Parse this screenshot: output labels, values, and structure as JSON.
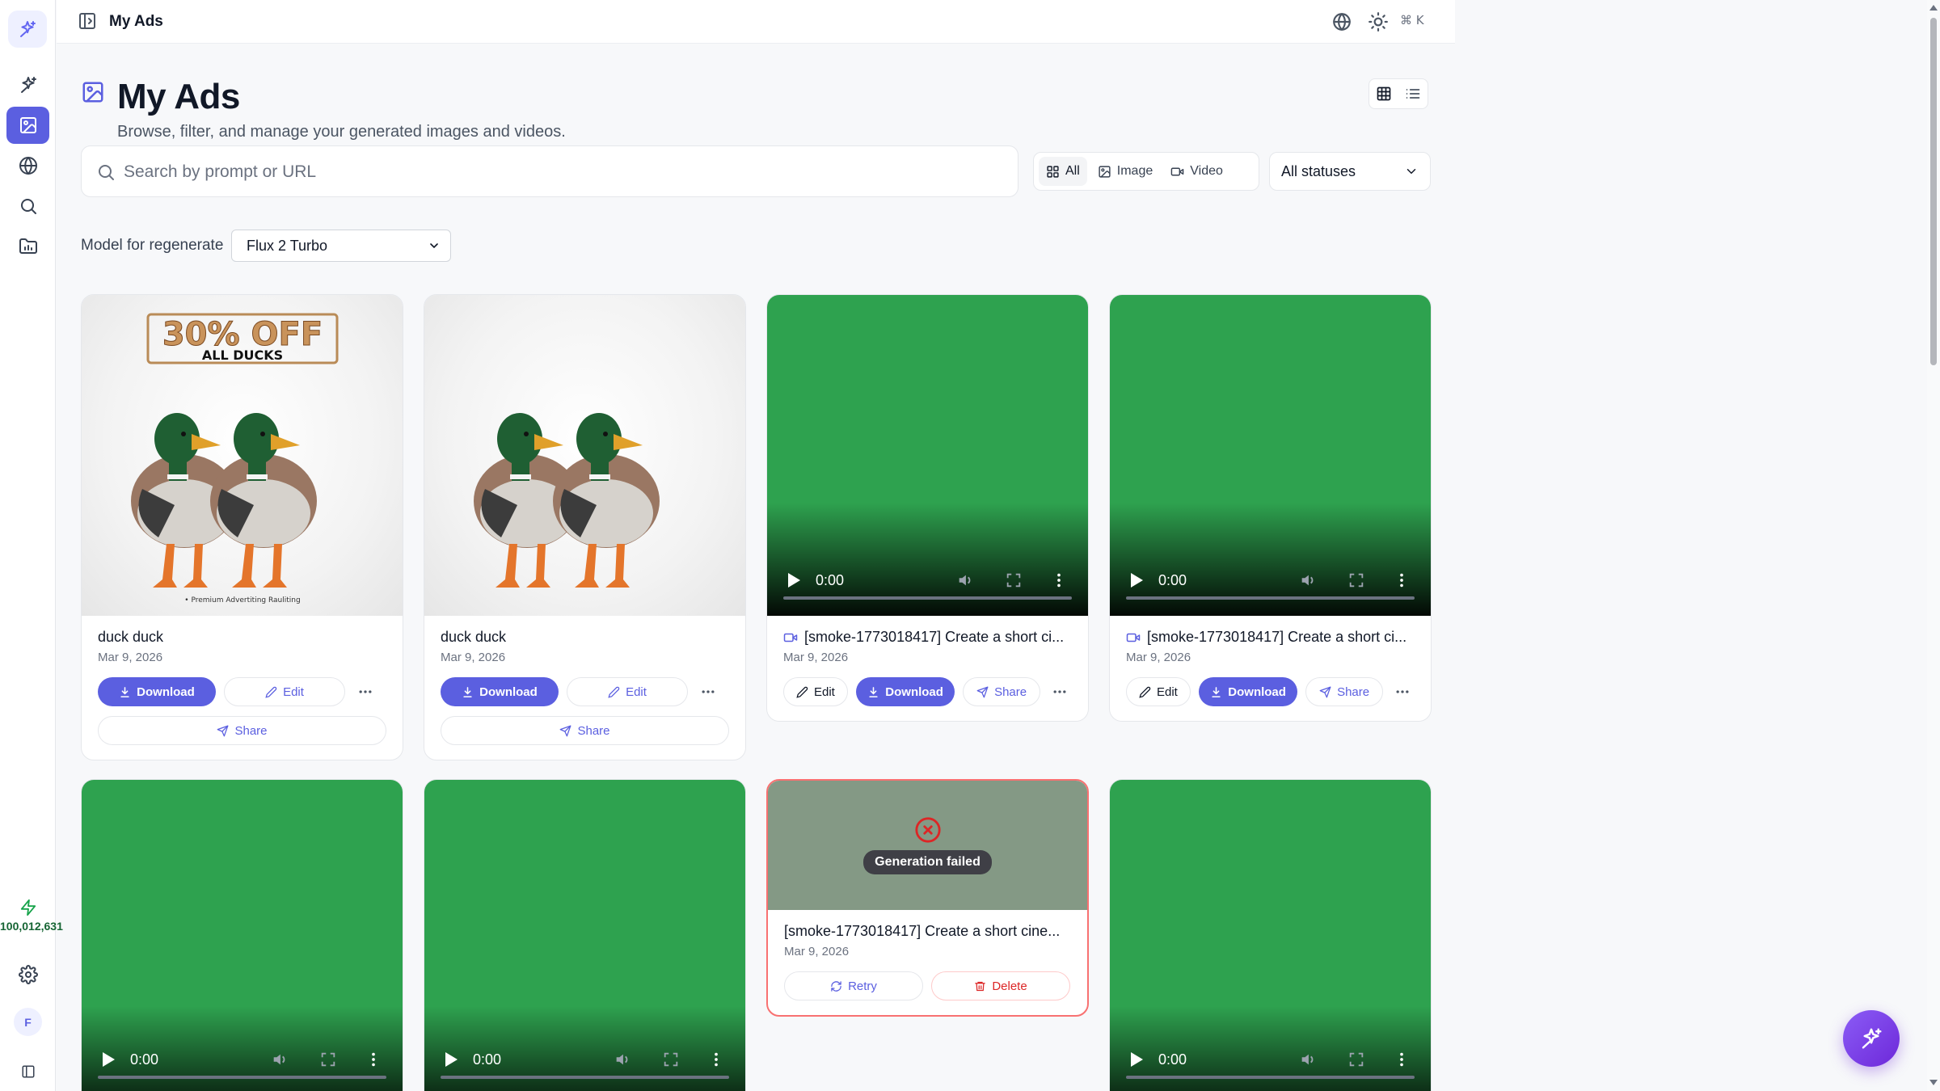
{
  "app": {
    "page_title": "My Ads",
    "heading": "My Ads",
    "subtitle": "Browse, filter, and manage your generated images and videos.",
    "shortcut": "⌘ K",
    "credits": "100,012,631",
    "avatar_initial": "F"
  },
  "search": {
    "placeholder": "Search by prompt or URL",
    "value": ""
  },
  "filters": {
    "types": [
      {
        "label": "All",
        "icon": "grid-icon",
        "active": true
      },
      {
        "label": "Image",
        "icon": "image-icon",
        "active": false
      },
      {
        "label": "Video",
        "icon": "video-icon",
        "active": false
      }
    ],
    "status": "All statuses"
  },
  "model": {
    "label": "Model for regenerate",
    "value": "Flux 2 Turbo"
  },
  "cards": [
    {
      "kind": "image",
      "title": "duck duck",
      "date": "Mar 9, 2026",
      "download": "Download",
      "edit": "Edit",
      "share": "Share",
      "ad_headline": "30% OFF",
      "ad_sub": "ALL DUCKS",
      "ad_footer": "• Premium Advertiting Rauliting"
    },
    {
      "kind": "image",
      "title": "duck duck",
      "date": "Mar 9, 2026",
      "download": "Download",
      "edit": "Edit",
      "share": "Share"
    },
    {
      "kind": "video",
      "title": "[smoke-1773018417] Create a short ci...",
      "date": "Mar 9, 2026",
      "edit": "Edit",
      "download": "Download",
      "share": "Share",
      "time": "0:00"
    },
    {
      "kind": "video",
      "title": "[smoke-1773018417] Create a short ci...",
      "date": "Mar 9, 2026",
      "edit": "Edit",
      "download": "Download",
      "share": "Share",
      "time": "0:00"
    },
    {
      "kind": "video",
      "time": "0:00"
    },
    {
      "kind": "video",
      "time": "0:00"
    },
    {
      "kind": "failed",
      "status": "Generation failed",
      "title": "[smoke-1773018417] Create a short cine...",
      "date": "Mar 9, 2026",
      "retry": "Retry",
      "delete": "Delete"
    },
    {
      "kind": "video",
      "time": "0:00"
    }
  ],
  "colors": {
    "accent": "#5b5fe0",
    "video_bg": "#2ea24f",
    "danger": "#dc2626",
    "credits": "#166534"
  }
}
